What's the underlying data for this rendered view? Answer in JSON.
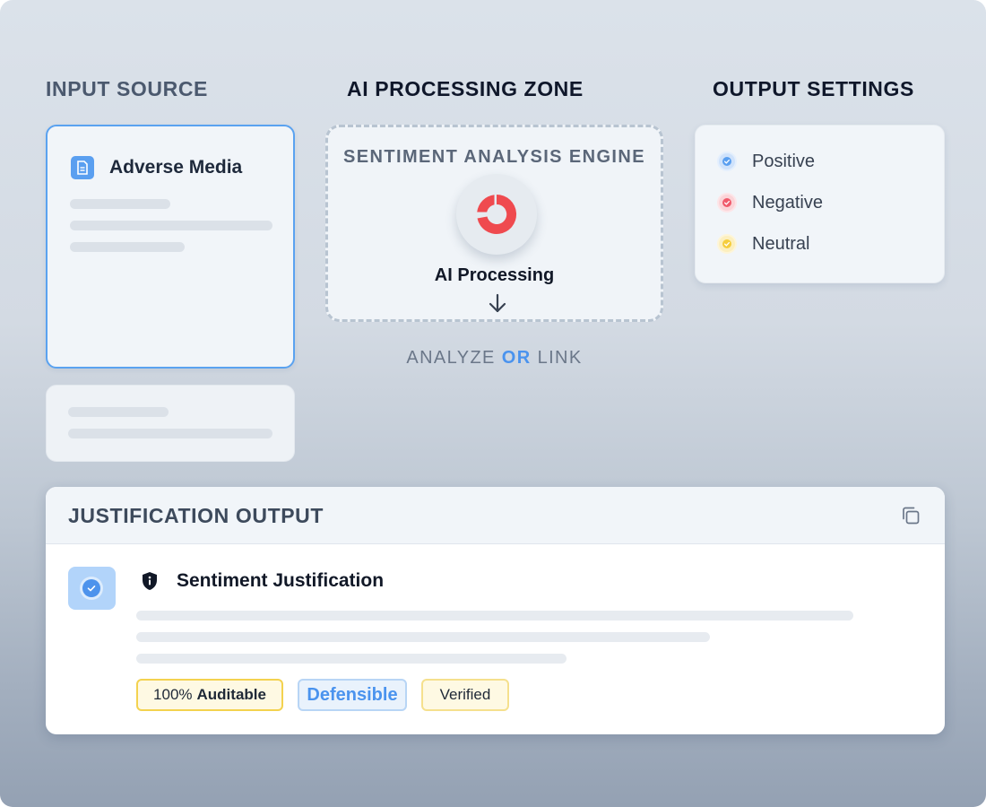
{
  "columns": {
    "input_title": "INPUT SOURCE",
    "ai_title": "AI PROCESSING ZONE",
    "output_title": "OUTPUT SETTINGS"
  },
  "input_source": {
    "card_title": "Adverse Media",
    "icon": "document-icon"
  },
  "ai_zone": {
    "engine_title": "SENTIMENT ANALYSIS ENGINE",
    "processing_label": "AI Processing",
    "analyze_label": "ANALYZE",
    "or_label": "OR",
    "link_label": "LINK"
  },
  "output_settings": {
    "options": [
      {
        "label": "Positive",
        "color": "#5a9ff0"
      },
      {
        "label": "Negative",
        "color": "#f05a6b"
      },
      {
        "label": "Neutral",
        "color": "#f5cd3c"
      }
    ]
  },
  "justification": {
    "header_title": "JUSTIFICATION OUTPUT",
    "section_title": "Sentiment Justification",
    "badges": {
      "auditable_prefix": "100%",
      "auditable_label": "Auditable",
      "defensible": "Defensible",
      "verified": "Verified"
    }
  },
  "colors": {
    "accent": "#4a93ee",
    "logo_red": "#ef4a4f"
  }
}
